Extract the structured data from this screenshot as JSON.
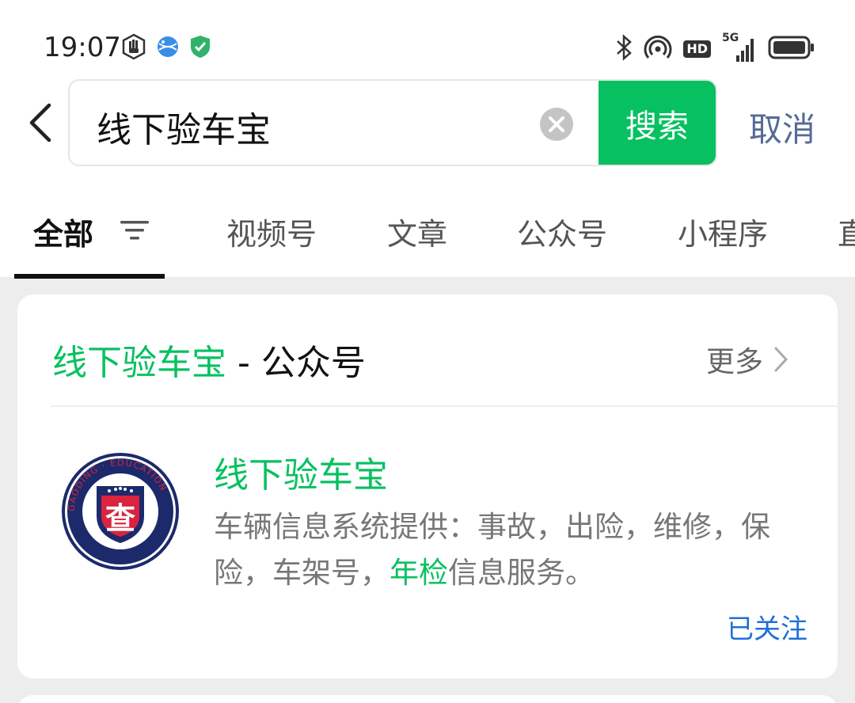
{
  "status_bar": {
    "time": "19:07",
    "hd_label": "HD",
    "net_label": "5G",
    "left_icons": [
      "hand-icon",
      "globe-icon",
      "shield-check-icon"
    ],
    "right_icons": [
      "bluetooth-icon",
      "hotspot-icon",
      "hd-icon",
      "signal-icon",
      "battery-icon"
    ]
  },
  "search": {
    "query": "线下验车宝",
    "search_button": "搜索",
    "cancel_button": "取消"
  },
  "tabs": [
    {
      "label": "全部",
      "active": true
    },
    {
      "label": "视频号"
    },
    {
      "label": "文章"
    },
    {
      "label": "公众号"
    },
    {
      "label": "小程序"
    },
    {
      "label": "直"
    }
  ],
  "result_card": {
    "header_highlight": "线下验车宝",
    "header_suffix": " - 公众号",
    "more_label": "更多",
    "account": {
      "name": "线下验车宝",
      "desc_part1": "车辆信息系统提供：事故，出险，维修，保险，车架号，",
      "desc_highlight": "年检",
      "desc_part2": "信息服务。",
      "follow_status": "已关注",
      "avatar": {
        "ring_text": "GAODING · EDUCATION",
        "center_char": "查",
        "ring_color": "#1c2a6b",
        "accent_color": "#d9233f"
      }
    }
  },
  "colors": {
    "brand_green": "#07c160",
    "link_blue": "#576b95",
    "followed_blue": "#1e6fd9"
  }
}
